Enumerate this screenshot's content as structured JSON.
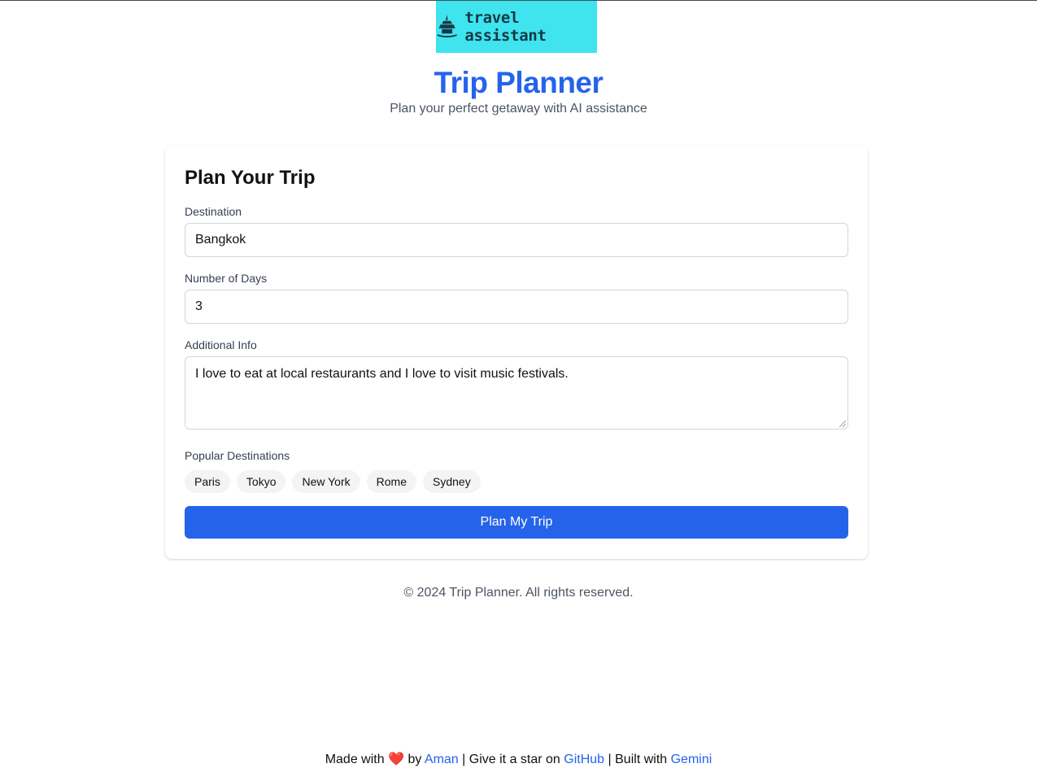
{
  "header": {
    "logo_text": "travel assistant",
    "title": "Trip Planner",
    "subtitle": "Plan your perfect getaway with AI assistance"
  },
  "form": {
    "heading": "Plan Your Trip",
    "destination": {
      "label": "Destination",
      "value": "Bangkok"
    },
    "days": {
      "label": "Number of Days",
      "value": "3"
    },
    "info": {
      "label": "Additional Info",
      "value": "I love to eat at local restaurants and I love to visit music festivals."
    },
    "popular": {
      "label": "Popular Destinations",
      "items": [
        "Paris",
        "Tokyo",
        "New York",
        "Rome",
        "Sydney"
      ]
    },
    "submit_label": "Plan My Trip"
  },
  "copyright": "© 2024 Trip Planner. All rights reserved.",
  "footer": {
    "made_with": "Made with",
    "heart": "❤️",
    "by": "by",
    "author": "Aman",
    "sep1": "| Give it a star on",
    "github": "GitHub",
    "sep2": "| Built with",
    "gemini": "Gemini"
  },
  "colors": {
    "accent": "#2563eb",
    "logo_bg": "#3fe4ee"
  }
}
